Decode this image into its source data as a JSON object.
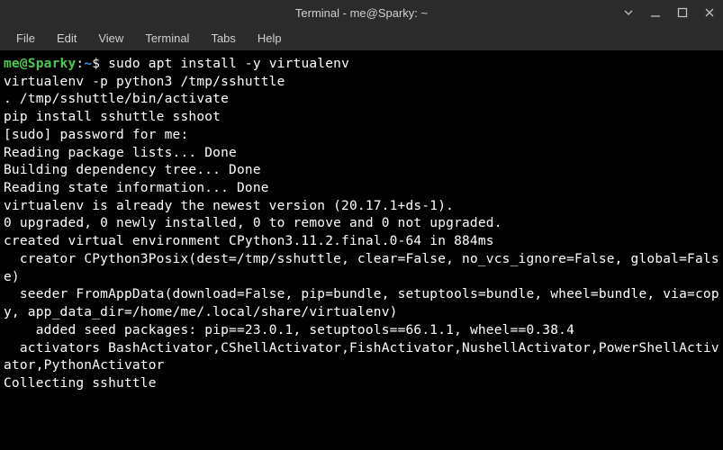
{
  "window": {
    "title": "Terminal - me@Sparky: ~"
  },
  "menu": {
    "file": "File",
    "edit": "Edit",
    "view": "View",
    "terminal": "Terminal",
    "tabs": "Tabs",
    "help": "Help"
  },
  "prompt": {
    "userhost": "me@Sparky",
    "colon": ":",
    "path": "~",
    "dollar": "$ "
  },
  "terminal": {
    "cmd1": "sudo apt install -y virtualenv",
    "cmd2": "virtualenv -p python3 /tmp/sshuttle",
    "cmd3": ". /tmp/sshuttle/bin/activate",
    "cmd4": "pip install sshuttle sshoot",
    "out1": "[sudo] password for me: ",
    "out2": "Reading package lists... Done",
    "out3": "Building dependency tree... Done",
    "out4": "Reading state information... Done",
    "out5": "virtualenv is already the newest version (20.17.1+ds-1).",
    "out6": "0 upgraded, 0 newly installed, 0 to remove and 0 not upgraded.",
    "out7": "created virtual environment CPython3.11.2.final.0-64 in 884ms",
    "out8": "  creator CPython3Posix(dest=/tmp/sshuttle, clear=False, no_vcs_ignore=False, global=False)",
    "out9": "  seeder FromAppData(download=False, pip=bundle, setuptools=bundle, wheel=bundle, via=copy, app_data_dir=/home/me/.local/share/virtualenv)",
    "out10": "    added seed packages: pip==23.0.1, setuptools==66.1.1, wheel==0.38.4",
    "out11": "  activators BashActivator,CShellActivator,FishActivator,NushellActivator,PowerShellActivator,PythonActivator",
    "out12": "Collecting sshuttle"
  }
}
